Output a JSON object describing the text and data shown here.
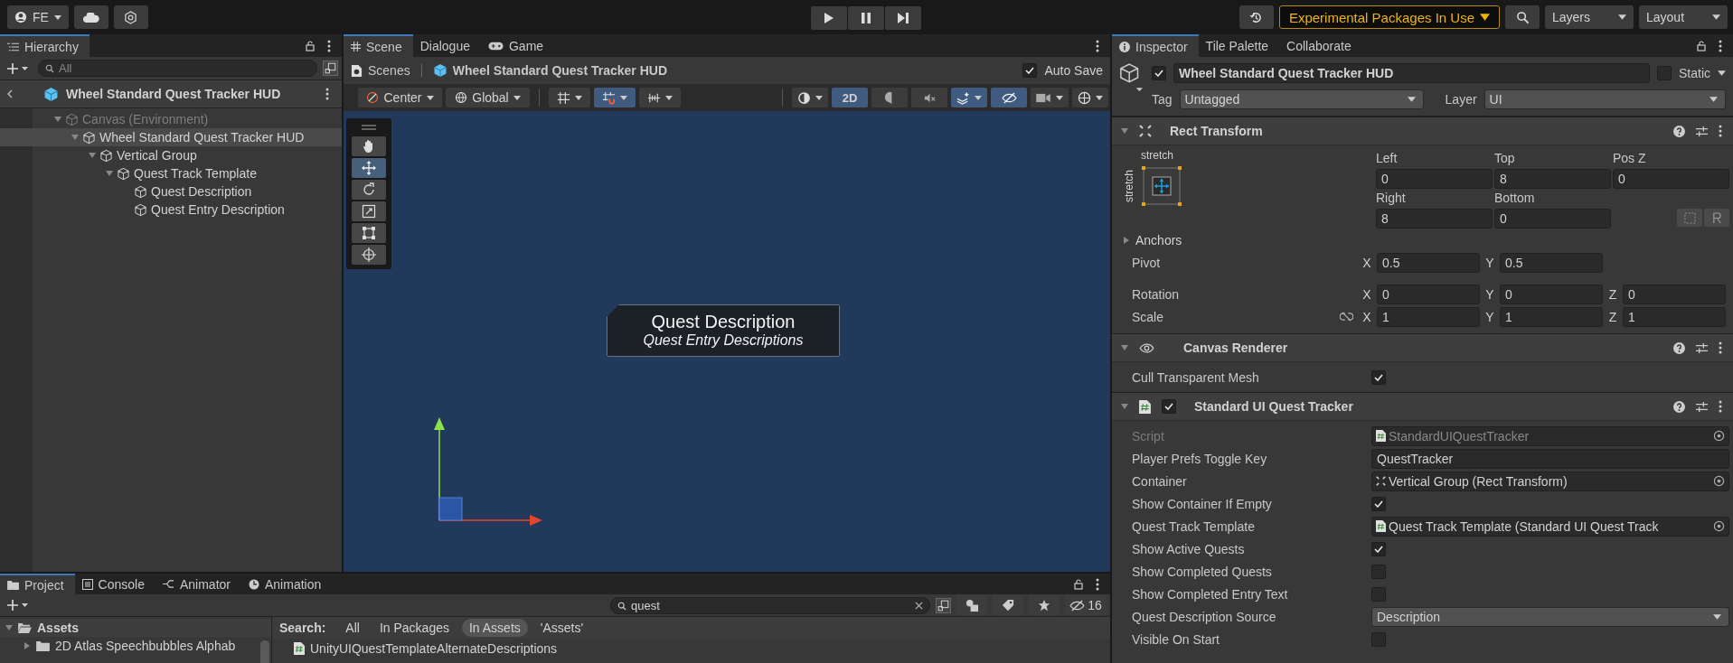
{
  "toolbar": {
    "account": "FE",
    "experimental": "Experimental Packages In Use",
    "layers": "Layers",
    "layout": "Layout"
  },
  "hierarchy": {
    "tab": "Hierarchy",
    "search": {
      "placeholder": "All"
    },
    "prefab_title": "Wheel Standard Quest Tracker HUD",
    "tree": [
      {
        "label": "Canvas (Environment)",
        "disabled": true,
        "selected": false,
        "expanded": true,
        "children": [
          {
            "label": "Wheel Standard Quest Tracker HUD",
            "disabled": false,
            "selected": true,
            "expanded": true,
            "children": [
              {
                "label": "Vertical Group",
                "disabled": false,
                "selected": false,
                "expanded": true,
                "children": [
                  {
                    "label": "Quest Track Template",
                    "disabled": false,
                    "selected": false,
                    "expanded": true,
                    "children": [
                      {
                        "label": "Quest Description",
                        "disabled": false,
                        "selected": false
                      },
                      {
                        "label": "Quest Entry Description",
                        "disabled": false,
                        "selected": false
                      }
                    ]
                  }
                ]
              }
            ]
          }
        ]
      }
    ]
  },
  "scene": {
    "tabs": [
      {
        "label": "Scene",
        "kind": "scene",
        "selected": true
      },
      {
        "label": "Dialogue",
        "kind": "plain",
        "selected": false
      },
      {
        "label": "Game",
        "kind": "game",
        "selected": false
      }
    ],
    "breadcrumb": [
      "Scenes",
      "Wheel Standard Quest Tracker HUD"
    ],
    "auto_save": {
      "label": "Auto Save",
      "checked": true
    },
    "pivot_mode": "Center",
    "pivot_space": "Global",
    "snap_tools": [
      {
        "kind": "grid",
        "on": false
      },
      {
        "kind": "snap",
        "on": true
      },
      {
        "kind": "increment",
        "on": false
      }
    ],
    "view_tools": [
      {
        "kind": "shading",
        "on": false
      },
      {
        "kind": "mode2d",
        "label": "2D",
        "on": true
      },
      {
        "kind": "lighting",
        "on": false
      },
      {
        "kind": "audio",
        "on": false
      },
      {
        "kind": "effects",
        "on": true
      },
      {
        "kind": "hidden",
        "on": true
      },
      {
        "kind": "camera",
        "on": false
      },
      {
        "kind": "gizmos",
        "on": false
      }
    ],
    "tools": [
      {
        "kind": "hand",
        "selected": false
      },
      {
        "kind": "move",
        "selected": true
      },
      {
        "kind": "rotate",
        "selected": false
      },
      {
        "kind": "scale",
        "selected": false
      },
      {
        "kind": "rect",
        "selected": false
      },
      {
        "kind": "transform",
        "selected": false
      }
    ],
    "ui_element": {
      "title": "Quest Description",
      "subtitle": "Quest Entry Descriptions"
    }
  },
  "project": {
    "tabs": [
      {
        "label": "Project",
        "kind": "folder",
        "selected": true
      },
      {
        "label": "Console",
        "kind": "console",
        "selected": false
      },
      {
        "label": "Animator",
        "kind": "animator",
        "selected": false
      },
      {
        "label": "Animation",
        "kind": "animation",
        "selected": false
      }
    ],
    "search": {
      "value": "quest"
    },
    "hidden_count": "16",
    "folders": [
      {
        "label": "Assets",
        "expanded": true,
        "children": [
          {
            "label": "2D Atlas Speechbubbles Alphab",
            "expanded": false
          }
        ]
      }
    ],
    "search_label": "Search:",
    "scopes": [
      {
        "label": "All",
        "selected": false
      },
      {
        "label": "In Packages",
        "selected": false
      },
      {
        "label": "In Assets",
        "selected": true
      },
      {
        "label": "'Assets'",
        "selected": false
      }
    ],
    "results": [
      "UnityUIQuestTemplateAlternateDescriptions"
    ]
  },
  "inspector": {
    "tabs": [
      {
        "label": "Inspector",
        "selected": true
      },
      {
        "label": "Tile Palette",
        "selected": false
      },
      {
        "label": "Collaborate",
        "selected": false
      }
    ],
    "object": {
      "active": true,
      "name": "Wheel Standard Quest Tracker HUD",
      "static_label": "Static",
      "static": false,
      "tag_label": "Tag",
      "tag": "Untagged",
      "layer_label": "Layer",
      "layer": "UI"
    },
    "rect_transform": {
      "title": "Rect Transform",
      "expanded": true,
      "anchor_h": "stretch",
      "anchor_v": "stretch",
      "fields": [
        {
          "label": "Left",
          "value": "0"
        },
        {
          "label": "Top",
          "value": "8"
        },
        {
          "label": "Pos Z",
          "value": "0"
        },
        {
          "label": "Right",
          "value": "8"
        },
        {
          "label": "Bottom",
          "value": "0"
        }
      ],
      "anchors": {
        "label": "Anchors",
        "expanded": false
      },
      "pivot": {
        "label": "Pivot",
        "values": [
          {
            "axis": "X",
            "value": "0.5"
          },
          {
            "axis": "Y",
            "value": "0.5"
          }
        ]
      },
      "rotation": {
        "label": "Rotation",
        "values": [
          {
            "axis": "X",
            "value": "0"
          },
          {
            "axis": "Y",
            "value": "0"
          },
          {
            "axis": "Z",
            "value": "0"
          }
        ]
      },
      "scale": {
        "label": "Scale",
        "values": [
          {
            "axis": "X",
            "value": "1"
          },
          {
            "axis": "Y",
            "value": "1"
          },
          {
            "axis": "Z",
            "value": "1"
          }
        ]
      }
    },
    "components": [
      {
        "title": "Canvas Renderer",
        "kind": "eye",
        "expanded": true,
        "rows": [
          {
            "label": "Cull Transparent Mesh",
            "kind": "checkbox",
            "checked": true,
            "disabled": false
          }
        ]
      },
      {
        "title": "Standard UI Quest Tracker",
        "kind": "script",
        "expanded": true,
        "enabled": true,
        "rows": [
          {
            "label": "Script",
            "kind": "script_ref",
            "value": "StandardUIQuestTracker",
            "disabled": true
          },
          {
            "label": "Player Prefs Toggle Key",
            "kind": "text",
            "value": "QuestTracker",
            "disabled": false
          },
          {
            "label": "Container",
            "kind": "component_ref",
            "value": "Vertical Group (Rect Transform)",
            "disabled": false
          },
          {
            "label": "Show Container If Empty",
            "kind": "checkbox",
            "checked": true,
            "disabled": false
          },
          {
            "label": "Quest Track Template",
            "kind": "script_ref",
            "value": "Quest Track Template (Standard UI Quest Track",
            "disabled": false
          },
          {
            "label": "Show Active Quests",
            "kind": "checkbox",
            "checked": true,
            "disabled": false
          },
          {
            "label": "Show Completed Quests",
            "kind": "checkbox",
            "checked": false,
            "disabled": false
          },
          {
            "label": "Show Completed Entry Text",
            "kind": "checkbox",
            "checked": false,
            "disabled": false
          },
          {
            "label": "Quest Description Source",
            "kind": "dropdown",
            "value": "Description",
            "disabled": false
          },
          {
            "label": "Visible On Start",
            "kind": "checkbox",
            "checked": false,
            "disabled": false
          }
        ]
      }
    ]
  }
}
